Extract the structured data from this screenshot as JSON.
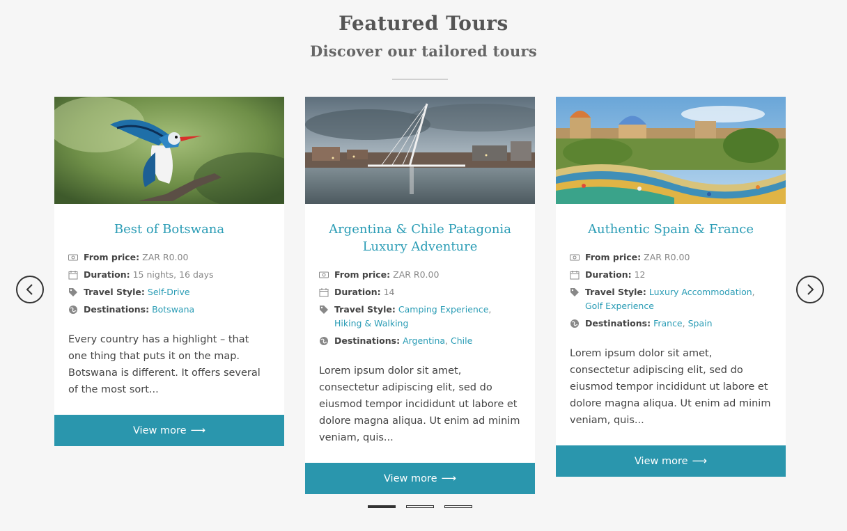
{
  "header": {
    "title": "Featured Tours",
    "subtitle": "Discover our tailored tours"
  },
  "carousel": {
    "prev_icon": "chevron-left-icon",
    "next_icon": "chevron-right-icon",
    "pagination": {
      "count": 3,
      "active_index": 0
    }
  },
  "labels": {
    "from_price": "From price:",
    "duration": "Duration:",
    "travel_style": "Travel Style:",
    "destinations": "Destinations:"
  },
  "tours": [
    {
      "title": "Best of Botswana",
      "price": "ZAR R0.00",
      "duration": "15 nights, 16 days",
      "travel_styles": [
        "Self-Drive"
      ],
      "destinations": [
        "Botswana"
      ],
      "description": "Every country has a highlight – that one thing that puts it on the map. Botswana is different. It offers several of the most sort...",
      "button": "View more"
    },
    {
      "title": "Argentina & Chile Patagonia Luxury Adventure",
      "price": "ZAR R0.00",
      "duration": "14",
      "travel_styles": [
        "Camping Experience",
        "Hiking & Walking"
      ],
      "destinations": [
        "Argentina",
        "Chile"
      ],
      "description": "Lorem ipsum dolor sit amet, consectetur adipiscing elit, sed do eiusmod tempor incididunt ut labore et dolore magna aliqua. Ut enim ad minim veniam, quis...",
      "button": "View more"
    },
    {
      "title": "Authentic Spain & France",
      "price": "ZAR R0.00",
      "duration": "12",
      "travel_styles": [
        "Luxury Accommodation",
        "Golf Experience"
      ],
      "destinations": [
        "France",
        "Spain"
      ],
      "description": "Lorem ipsum dolor sit amet, consectetur adipiscing elit, sed do eiusmod tempor incididunt ut labore et dolore magna aliqua. Ut enim ad minim veniam, quis...",
      "button": "View more"
    }
  ],
  "icons": {
    "price": "money-icon",
    "duration": "calendar-icon",
    "style": "tag-icon",
    "destinations": "globe-icon",
    "button_arrow": "long-arrow-right-icon"
  },
  "colors": {
    "accent": "#2a9cb5",
    "button": "#2a96ad",
    "background": "#f6f6f6"
  }
}
